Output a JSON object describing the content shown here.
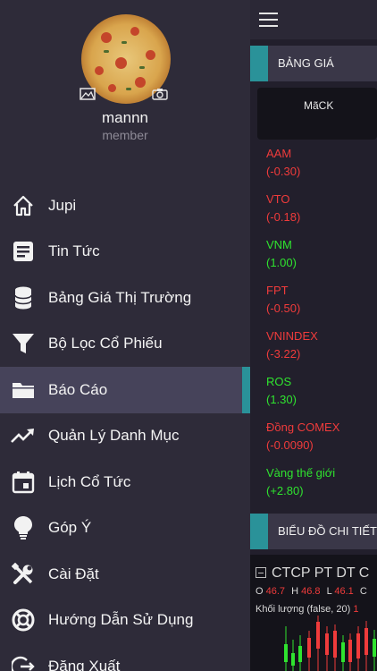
{
  "profile": {
    "username": "mannn",
    "role": "member"
  },
  "menu": {
    "items": [
      {
        "label": "Jupi",
        "icon": "home-icon"
      },
      {
        "label": "Tin Tức",
        "icon": "news-icon"
      },
      {
        "label": "Bảng Giá Thị Trường",
        "icon": "database-icon"
      },
      {
        "label": "Bộ Lọc Cổ Phiếu",
        "icon": "filter-icon"
      },
      {
        "label": "Báo Cáo",
        "icon": "folder-icon",
        "active": true
      },
      {
        "label": "Quản Lý Danh Mục",
        "icon": "trending-up-icon"
      },
      {
        "label": "Lịch Cổ Tức",
        "icon": "calendar-icon"
      },
      {
        "label": "Góp Ý",
        "icon": "lightbulb-icon"
      },
      {
        "label": "Cài Đặt",
        "icon": "tools-icon"
      },
      {
        "label": "Hướng Dẫn Sử Dụng",
        "icon": "lifebuoy-icon"
      },
      {
        "label": "Đăng Xuất",
        "icon": "logout-icon"
      }
    ]
  },
  "content": {
    "section1_title": "BẢNG GIÁ",
    "column_header": "MãCK",
    "quotes": [
      {
        "symbol": "AAM",
        "change": "(-0.30)",
        "status": "down"
      },
      {
        "symbol": "VTO",
        "change": "(-0.18)",
        "status": "down"
      },
      {
        "symbol": "VNM",
        "change": "(1.00)",
        "status": "up"
      },
      {
        "symbol": "FPT",
        "change": "(-0.50)",
        "status": "down"
      },
      {
        "symbol": "VNINDEX",
        "change": "(-3.22)",
        "status": "down"
      },
      {
        "symbol": "ROS",
        "change": "(1.30)",
        "status": "up"
      },
      {
        "symbol": "Đồng COMEX",
        "change": "(-0.0090)",
        "status": "down"
      },
      {
        "symbol": "Vàng thế giới",
        "change": "(+2.80)",
        "status": "up"
      }
    ],
    "section2_title": "BIỂU ĐỒ CHI TIẾT",
    "chart": {
      "title": "CTCP PT DT C",
      "o_label": "O",
      "o_value": "46.7",
      "h_label": "H",
      "h_value": "46.8",
      "l_label": "L",
      "l_value": "46.1",
      "c_label": "C",
      "volume_label": "Khối lượng (false, 20)",
      "volume_value": "1"
    }
  },
  "colors": {
    "accent": "#2a9299",
    "down": "#ef3b3b",
    "up": "#2fe32f",
    "drawer_bg": "#2e2b39",
    "active_bg": "#46435a"
  }
}
